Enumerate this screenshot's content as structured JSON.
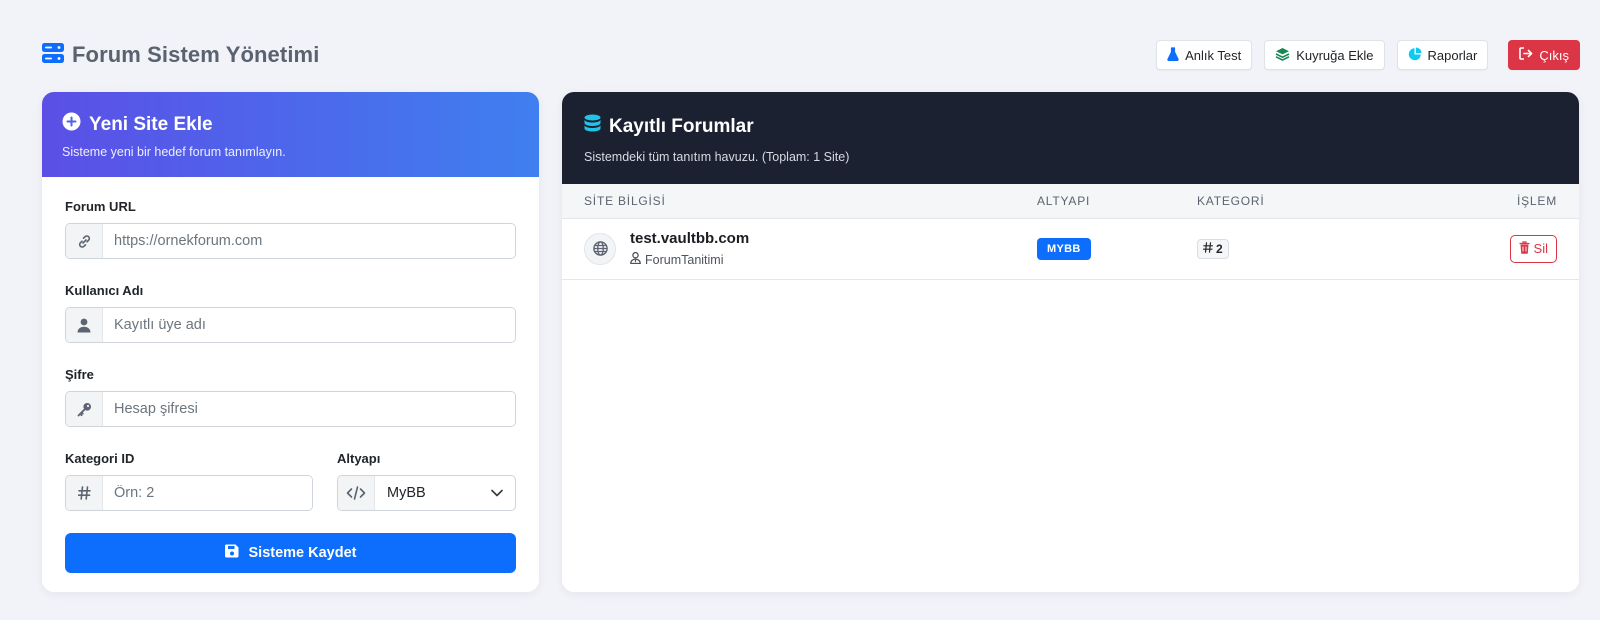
{
  "header": {
    "title": "Forum Sistem Yönetimi",
    "buttons": {
      "test": "Anlık Test",
      "queue": "Kuyruğa Ekle",
      "reports": "Raporlar",
      "logout": "Çıkış"
    }
  },
  "new_site": {
    "title": "Yeni Site Ekle",
    "subtitle": "Sisteme yeni bir hedef forum tanımlayın.",
    "url_label": "Forum URL",
    "url_placeholder": "https://ornekforum.com",
    "username_label": "Kullanıcı Adı",
    "username_placeholder": "Kayıtlı üye adı",
    "password_label": "Şifre",
    "password_placeholder": "Hesap şifresi",
    "category_label": "Kategori ID",
    "category_placeholder": "Örn: 2",
    "platform_label": "Altyapı",
    "platform_value": "MyBB",
    "save_label": "Sisteme Kaydet"
  },
  "forums": {
    "title": "Kayıtlı Forumlar",
    "subtitle": "Sistemdeki tüm tanıtım havuzu. (Toplam: 1 Site)",
    "columns": [
      "SİTE BİLGİSİ",
      "ALTYAPI",
      "KATEGORİ",
      "İŞLEM"
    ],
    "rows": [
      {
        "site": "test.vaultbb.com",
        "user": "ForumTanitimi",
        "platform": "MYBB",
        "category": "2",
        "action": "Sil"
      }
    ]
  },
  "colors": {
    "primary": "#0d6efd",
    "danger": "#dc3545",
    "dark_header": "#1b2130",
    "gradient_start": "#5b4fe6",
    "gradient_end": "#3f7ff0",
    "brand_icon": "#0d6efd",
    "db_icon": "#22c3e6"
  }
}
